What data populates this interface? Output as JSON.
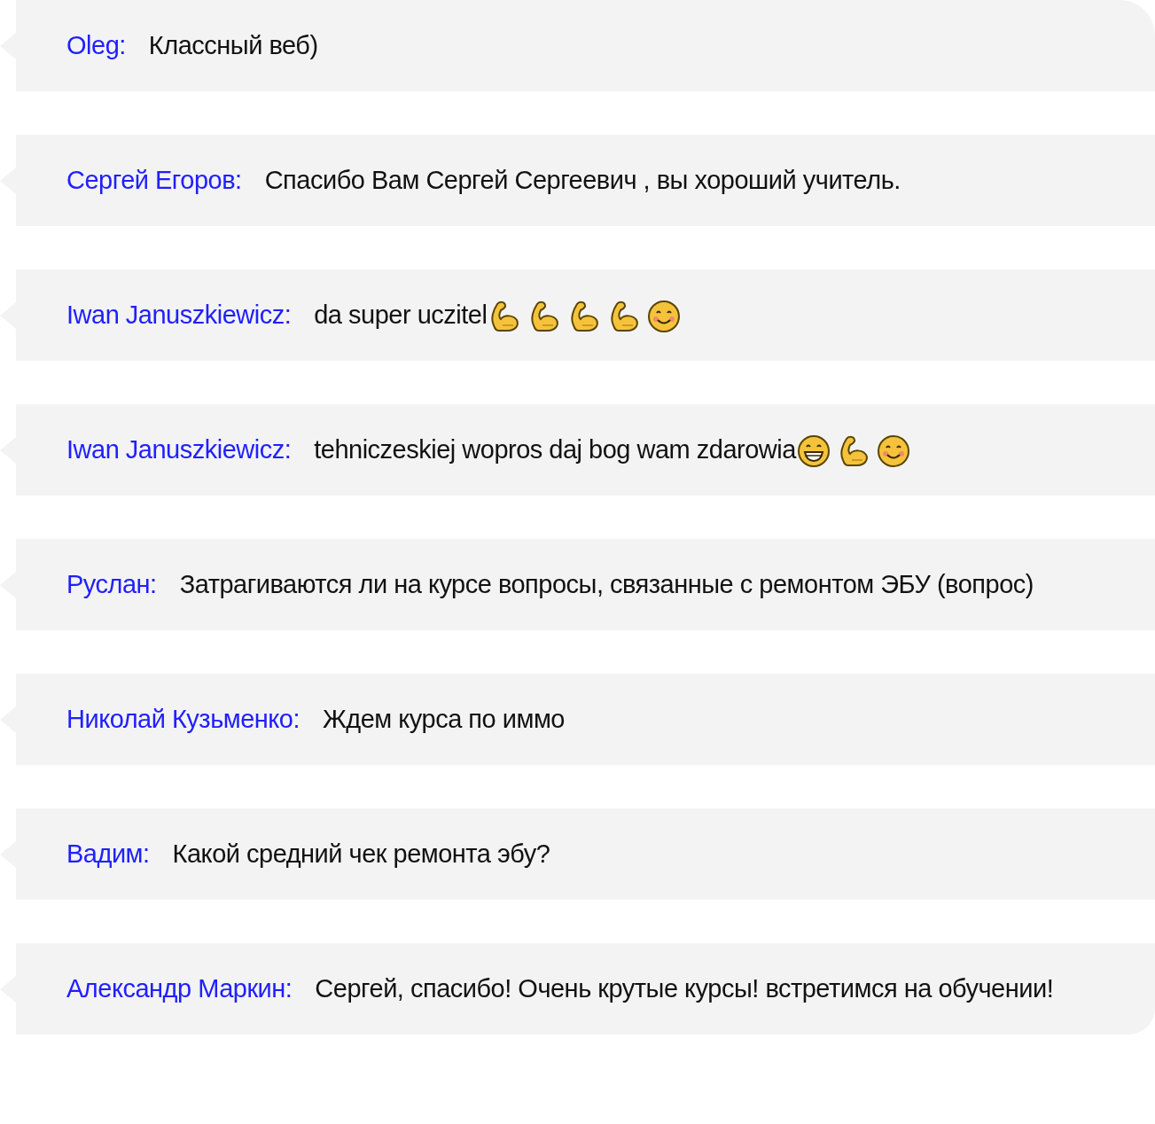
{
  "messages": [
    {
      "author": "Oleg:",
      "text": "Классный веб)"
    },
    {
      "author": "Сергей Егоров:",
      "text": "Спасибо Вам Сергей Сергеевич , вы хороший учитель."
    },
    {
      "author": "Iwan Januszkiewicz:",
      "text": "da super uczitel",
      "emojis": [
        {
          "kind": "muscle"
        },
        {
          "kind": "muscle"
        },
        {
          "kind": "muscle"
        },
        {
          "kind": "muscle"
        },
        {
          "kind": "smile"
        }
      ]
    },
    {
      "author": "Iwan Januszkiewicz:",
      "text": "tehniczeskiej wopros daj bog wam zdarowia",
      "emojis": [
        {
          "kind": "grin"
        },
        {
          "kind": "muscle"
        },
        {
          "kind": "smile"
        }
      ]
    },
    {
      "author": "Руслан:",
      "text": "Затрагиваются ли на курсе вопросы, связанные с ремонтом ЭБУ (вопрос)"
    },
    {
      "author": "Николай Кузьменко:",
      "text": "Ждем курса по иммо"
    },
    {
      "author": "Вадим:",
      "text": "Какой средний чек ремонта эбу?"
    },
    {
      "author": "Александр Маркин:",
      "text": "Сергей, спасибо! Очень крутые курсы! встретимся на обучении!"
    }
  ]
}
